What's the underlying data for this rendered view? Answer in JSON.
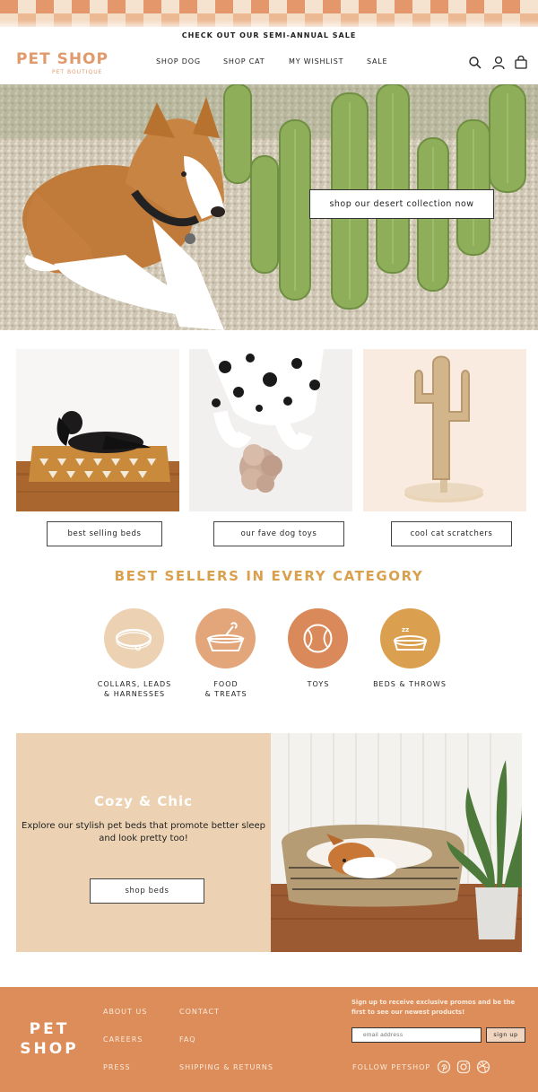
{
  "promo": {
    "text": "CHECK OUT OUR SEMI-ANNUAL SALE"
  },
  "header": {
    "logo": "PET SHOP",
    "logo_sub": "PET BOUTIQUE",
    "nav": [
      "SHOP DOG",
      "SHOP CAT",
      "MY WISHLIST",
      "SALE"
    ],
    "icons": [
      "search-icon",
      "account-icon",
      "bag-icon"
    ]
  },
  "hero": {
    "cta": "shop our desert collection now"
  },
  "tiles": [
    {
      "label": "best selling beds"
    },
    {
      "label": "our fave dog toys"
    },
    {
      "label": "cool cat scratchers"
    }
  ],
  "best_sellers": {
    "title": "BEST SELLERS IN EVERY CATEGORY",
    "categories": [
      {
        "label": "COLLARS, LEADS\n& HARNESSES",
        "color": "#ecd2b3",
        "icon": "collar-icon"
      },
      {
        "label": "FOOD\n& TREATS",
        "color": "#e3a57a",
        "icon": "food-bowl-icon"
      },
      {
        "label": "TOYS",
        "color": "#d9895a",
        "icon": "ball-icon"
      },
      {
        "label": "BEDS & THROWS",
        "color": "#dba04f",
        "icon": "pet-bed-icon"
      }
    ]
  },
  "cozy": {
    "title": "Cozy & Chic",
    "text": "Explore our stylish pet beds that promote better sleep and look pretty too!",
    "cta": "shop beds"
  },
  "footer": {
    "logo_top": "PET",
    "logo_bottom": "SHOP",
    "links_col1": [
      "ABOUT US",
      "CAREERS",
      "PRESS"
    ],
    "links_col2": [
      "CONTACT",
      "FAQ",
      "SHIPPING & RETURNS"
    ],
    "signup_text": "Sign up to receive exclusive promos and be the first to see our newest products!",
    "email_placeholder": "email address",
    "signup_button": "sign up",
    "follow": "FOLLOW PETSHOP",
    "social": [
      "pinterest-icon",
      "instagram-icon",
      "dribbble-icon"
    ]
  }
}
